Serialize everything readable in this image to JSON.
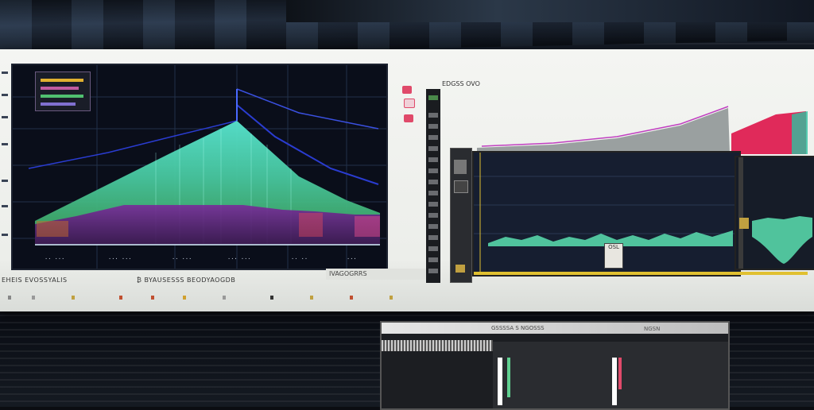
{
  "spectrum_panel": {
    "legend_label": "",
    "caption_left": "EHEIS EVOSSYALIS",
    "caption_mid": "₿ BYAUSESSS BEODYAOGDB",
    "caption_right": "IVAGOGRRS"
  },
  "right_panel": {
    "header_text": "EDGSS OVO",
    "badge_text": "OSL"
  },
  "lower_panel": {
    "header_text": "GSSSSA S NGOSSS",
    "header_right": "NGSN"
  },
  "colors": {
    "background": "#0b0d12",
    "panel": "#f4f5f2",
    "spectrum_bg": "#0a0e1a",
    "spectrum_cyan": "#54e0c8",
    "spectrum_green": "#7cf08a",
    "spectrum_purple": "#6a1e8a",
    "spectrum_blue": "#2a3cd0",
    "right_gray": "#9aa0a0",
    "right_red": "#e02a5a",
    "accent_yellow": "#f0c030"
  },
  "icons": [
    "pin-icon",
    "record-icon",
    "marker-icon"
  ]
}
